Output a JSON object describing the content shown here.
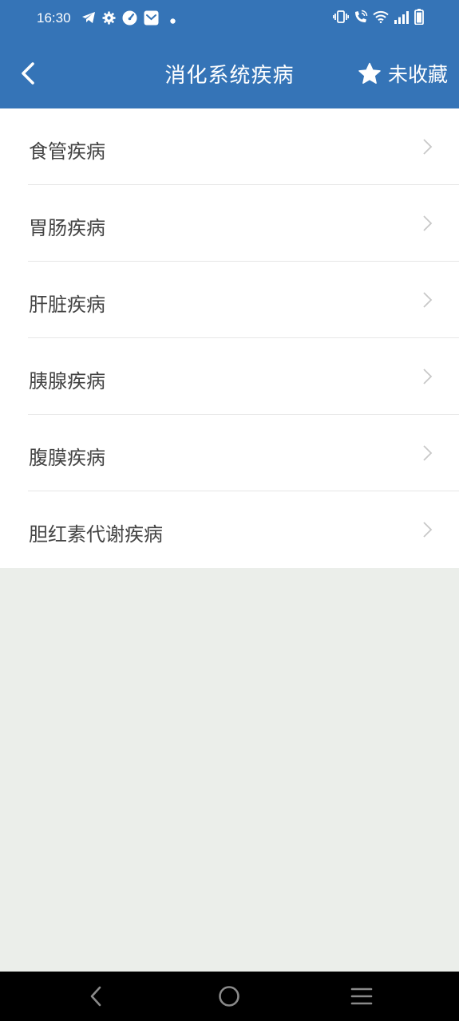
{
  "status_bar": {
    "time": "16:30",
    "left_icons": [
      "telegram-icon",
      "settings-icon",
      "speedometer-icon",
      "mail-icon",
      "dot-icon"
    ],
    "right_icons": [
      "vibrate-icon",
      "wifi-calling-icon",
      "wifi-icon",
      "signal-icon",
      "battery-icon"
    ]
  },
  "header": {
    "title": "消化系统疾病",
    "favorite_label": "未收藏",
    "color": "#3574b7"
  },
  "list": {
    "items": [
      {
        "label": "食管疾病"
      },
      {
        "label": "胃肠疾病"
      },
      {
        "label": "肝脏疾病"
      },
      {
        "label": "胰腺疾病"
      },
      {
        "label": "腹膜疾病"
      },
      {
        "label": "胆红素代谢疾病"
      }
    ]
  },
  "nav_bar": {
    "buttons": [
      "back-nav-icon",
      "home-nav-icon",
      "recents-nav-icon"
    ]
  }
}
